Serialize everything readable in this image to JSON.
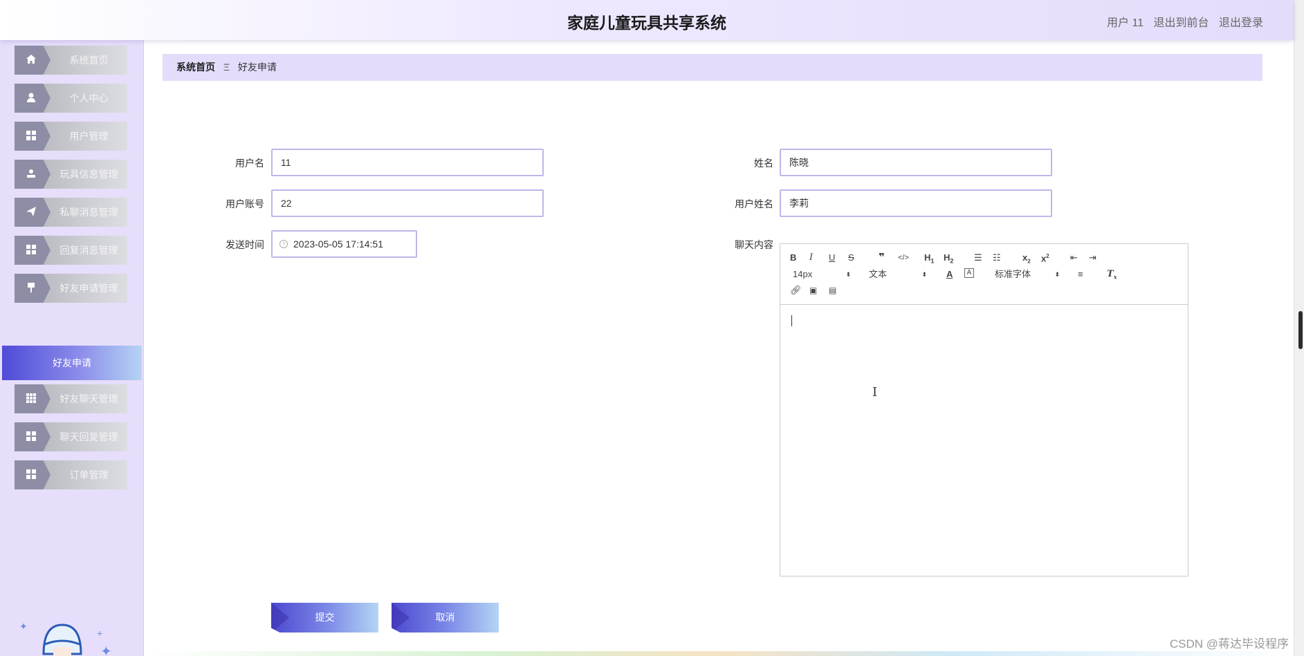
{
  "header": {
    "title": "家庭儿童玩具共享系统",
    "user": "用户 11",
    "to_front": "退出到前台",
    "logout": "退出登录"
  },
  "sidebar": {
    "items": [
      {
        "label": "系统首页",
        "icon": "home-icon"
      },
      {
        "label": "个人中心",
        "icon": "user-icon"
      },
      {
        "label": "用户管理",
        "icon": "grid-icon"
      },
      {
        "label": "玩具信息管理",
        "icon": "person-icon"
      },
      {
        "label": "私聊消息管理",
        "icon": "send-icon"
      },
      {
        "label": "回复消息管理",
        "icon": "grid-icon"
      },
      {
        "label": "好友申请管理",
        "icon": "pin-icon"
      },
      {
        "label": "好友聊天管理",
        "icon": "apps-icon"
      },
      {
        "label": "聊天回复管理",
        "icon": "grid-icon"
      },
      {
        "label": "订单管理",
        "icon": "grid-icon"
      }
    ],
    "active": "好友申请"
  },
  "breadcrumb": {
    "home": "系统首页",
    "separator": "Ξ",
    "current": "好友申请"
  },
  "form": {
    "username_label": "用户名",
    "username_value": "11",
    "name_label": "姓名",
    "name_value": "陈晓",
    "account_label": "用户账号",
    "account_value": "22",
    "realname_label": "用户姓名",
    "realname_value": "李莉",
    "time_label": "发送时间",
    "time_value": "2023-05-05 17:14:51",
    "content_label": "聊天内容"
  },
  "editor": {
    "font_size": "14px",
    "block_type": "文本",
    "font_family": "标准字体"
  },
  "buttons": {
    "submit": "提交",
    "cancel": "取消"
  },
  "watermark": "CSDN @蒋达毕设程序"
}
